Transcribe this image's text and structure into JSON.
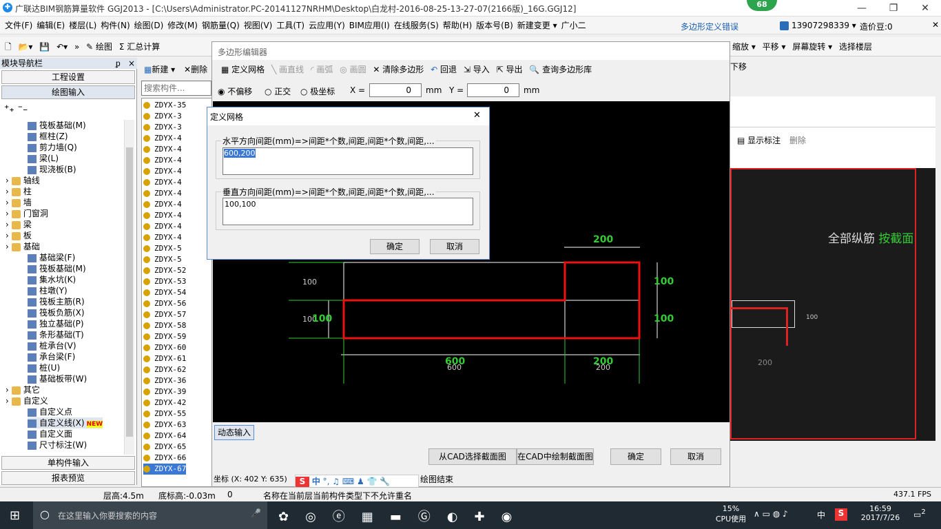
{
  "window": {
    "title": "广联达BIM钢筋算量软件 GGJ2013 - [C:\\Users\\Administrator.PC-20141127NRHM\\Desktop\\白龙村-2016-08-25-13-27-07(2166版)_16G.GGJ12]",
    "badge": "68",
    "min": "—",
    "restore": "❐",
    "close": "✕"
  },
  "menu": {
    "items": [
      "文件(F)",
      "编辑(E)",
      "楼层(L)",
      "构件(N)",
      "绘图(D)",
      "修改(M)",
      "钢筋量(Q)",
      "视图(V)",
      "工具(T)",
      "云应用(Y)",
      "BIM应用(I)",
      "在线服务(S)",
      "帮助(H)",
      "版本号(B)",
      "新建变更 ▾",
      "广小二"
    ],
    "error_text": "多边形定义错误",
    "phone": "13907298339 ▾",
    "price": "造价豆:0"
  },
  "toolbar": {
    "draw": "绘图",
    "sum": "汇总计算",
    "zoom": "缩放 ▾",
    "pan": "平移 ▾",
    "rotate": "屏幕旋转 ▾",
    "select_floor": "选择楼层",
    "move_down": "下移"
  },
  "nav": {
    "header": "模块导航栏",
    "pin": "ᵱ",
    "close": "×",
    "btn1": "工程设置",
    "btn2": "绘图输入",
    "btn3": "单构件输入",
    "btn4": "报表预览",
    "tree": [
      {
        "label": "筏板基础(M)",
        "level": 2,
        "kind": "comp"
      },
      {
        "label": "框柱(Z)",
        "level": 2,
        "kind": "comp"
      },
      {
        "label": "剪力墙(Q)",
        "level": 2,
        "kind": "comp"
      },
      {
        "label": "梁(L)",
        "level": 2,
        "kind": "comp"
      },
      {
        "label": "现浇板(B)",
        "level": 2,
        "kind": "comp"
      },
      {
        "label": "轴线",
        "level": 1,
        "kind": "folder"
      },
      {
        "label": "柱",
        "level": 1,
        "kind": "folder"
      },
      {
        "label": "墙",
        "level": 1,
        "kind": "folder"
      },
      {
        "label": "门窗洞",
        "level": 1,
        "kind": "folder"
      },
      {
        "label": "梁",
        "level": 1,
        "kind": "folder"
      },
      {
        "label": "板",
        "level": 1,
        "kind": "folder"
      },
      {
        "label": "基础",
        "level": 1,
        "kind": "folder"
      },
      {
        "label": "基础梁(F)",
        "level": 2,
        "kind": "comp"
      },
      {
        "label": "筏板基础(M)",
        "level": 2,
        "kind": "comp"
      },
      {
        "label": "集水坑(K)",
        "level": 2,
        "kind": "comp"
      },
      {
        "label": "柱墩(Y)",
        "level": 2,
        "kind": "comp"
      },
      {
        "label": "筏板主筋(R)",
        "level": 2,
        "kind": "comp"
      },
      {
        "label": "筏板负筋(X)",
        "level": 2,
        "kind": "comp"
      },
      {
        "label": "独立基础(P)",
        "level": 2,
        "kind": "comp"
      },
      {
        "label": "条形基础(T)",
        "level": 2,
        "kind": "comp"
      },
      {
        "label": "桩承台(V)",
        "level": 2,
        "kind": "comp"
      },
      {
        "label": "承台梁(F)",
        "level": 2,
        "kind": "comp"
      },
      {
        "label": "桩(U)",
        "level": 2,
        "kind": "comp"
      },
      {
        "label": "基础板带(W)",
        "level": 2,
        "kind": "comp"
      },
      {
        "label": "其它",
        "level": 1,
        "kind": "folder"
      },
      {
        "label": "自定义",
        "level": 1,
        "kind": "folder"
      },
      {
        "label": "自定义点",
        "level": 2,
        "kind": "comp"
      },
      {
        "label": "自定义线(X)",
        "level": 2,
        "kind": "comp"
      },
      {
        "label": "自定义面",
        "level": 2,
        "kind": "comp"
      },
      {
        "label": "尺寸标注(W)",
        "level": 2,
        "kind": "comp"
      }
    ],
    "new_tag": "NEW"
  },
  "list": {
    "new": "新建 ▾",
    "delete": "删除",
    "search_placeholder": "搜索构件...",
    "rows": [
      "ZDYX-35",
      "ZDYX-3",
      "ZDYX-3",
      "ZDYX-4",
      "ZDYX-4",
      "ZDYX-4",
      "ZDYX-4",
      "ZDYX-4",
      "ZDYX-4",
      "ZDYX-4",
      "ZDYX-4",
      "ZDYX-4",
      "ZDYX-4",
      "ZDYX-5",
      "ZDYX-5",
      "ZDYX-52",
      "ZDYX-53",
      "ZDYX-54",
      "ZDYX-56",
      "ZDYX-57",
      "ZDYX-58",
      "ZDYX-59",
      "ZDYX-60",
      "ZDYX-61",
      "ZDYX-62",
      "ZDYX-36",
      "ZDYX-39",
      "ZDYX-42",
      "ZDYX-55",
      "ZDYX-63",
      "ZDYX-64",
      "ZDYX-65",
      "ZDYX-66",
      "ZDYX-67"
    ]
  },
  "editor": {
    "title": "多边形编辑器",
    "define_grid": "定义网格",
    "line": "画直线",
    "arc": "画弧",
    "circle": "画圆",
    "clear": "清除多边形",
    "undo": "回退",
    "import": "导入",
    "export": "导出",
    "query": "查询多边形库",
    "no_offset": "不偏移",
    "ortho": "正交",
    "polar": "极坐标",
    "x_label": "X =",
    "x_val": "0",
    "y_label": "Y =",
    "y_val": "0",
    "mm": "mm",
    "dynamic": "动态输入",
    "from_cad": "从CAD选择截面图",
    "draw_cad": "在CAD中绘制截面图",
    "ok": "确定",
    "cancel": "取消",
    "coord": "坐标 (X: 402 Y: 635)",
    "draw_end": "绘图结束"
  },
  "grid_dialog": {
    "title": "定义网格",
    "h_label": "水平方向间距(mm)=>间距*个数,间距,间距*个数,间距,...",
    "h_value": "600,200",
    "v_label": "垂直方向间距(mm)=>间距*个数,间距,间距*个数,间距,...",
    "v_value": "100,100",
    "ok": "确定",
    "cancel": "取消",
    "close": "✕"
  },
  "drawing": {
    "dim_top": "200",
    "dim_bottom_600": "600",
    "dim_bottom_200": "200",
    "dim_bottom_600_small": "600",
    "dim_bottom_200_small": "200",
    "dim_left_100": "100",
    "dim_left_100b": "100",
    "dim_left_100_green": "100",
    "dim_right_100a": "100",
    "dim_right_100b": "100"
  },
  "rightview": {
    "show_label": "显示标注",
    "delete": "删除",
    "text1": "全部纵筋",
    "text2": "按截面",
    "dim1": "100",
    "dim2": "200"
  },
  "status": {
    "floor_h": "层高:4.5m",
    "bottom_h": "底标高:-0.03m",
    "zero": "0",
    "message": "名称在当前层当前构件类型下不允许重名",
    "fps": "437.1 FPS"
  },
  "taskbar": {
    "search": "在这里输入你要搜索的内容",
    "cpu_pct": "15%",
    "cpu_label": "CPU使用",
    "lang": "中",
    "time": "16:59",
    "date": "2017/7/26",
    "notif": "2"
  },
  "ime": {
    "label": "中"
  }
}
